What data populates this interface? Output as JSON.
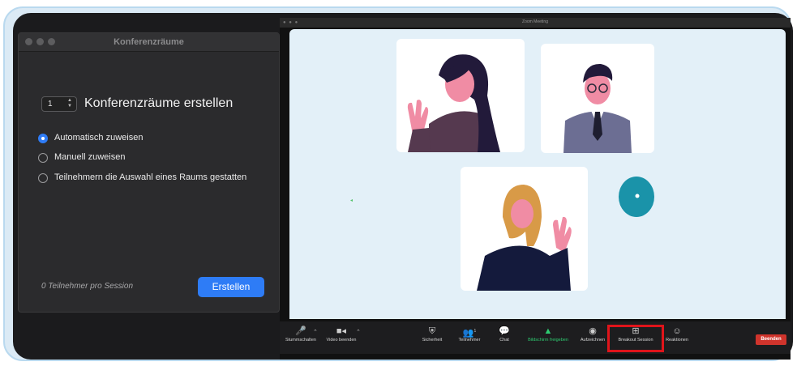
{
  "dialog": {
    "title": "Konferenzräume",
    "room_count": "1",
    "heading": "Konferenzräume erstellen",
    "options": [
      {
        "label": "Automatisch zuweisen",
        "selected": true
      },
      {
        "label": "Manuell zuweisen",
        "selected": false
      },
      {
        "label": "Teilnehmern die Auswahl eines Raums gestatten",
        "selected": false
      }
    ],
    "footnote": "0 Teilnehmer pro Session",
    "create_label": "Erstellen"
  },
  "zoom": {
    "window_title": "Zoom Meeting",
    "toolbar": [
      {
        "label": "Stummschalten",
        "icon": "microphone-icon"
      },
      {
        "label": "Video beenden",
        "icon": "video-camera-icon"
      },
      {
        "label": "Sicherheit",
        "icon": "shield-icon"
      },
      {
        "label": "Teilnehmer",
        "icon": "participants-icon",
        "count": "1"
      },
      {
        "label": "Chat",
        "icon": "chat-icon"
      },
      {
        "label": "Bildschirm freigeben",
        "icon": "share-screen-icon"
      },
      {
        "label": "Aufzeichnen",
        "icon": "record-icon"
      },
      {
        "label": "Breakout Session",
        "icon": "breakout-grid-icon"
      },
      {
        "label": "Reaktionen",
        "icon": "reactions-icon"
      }
    ],
    "end_label": "Beenden"
  },
  "colors": {
    "accent_blue": "#2f7cf6",
    "highlight_red": "#e0141a",
    "end_red": "#d0342c",
    "share_green": "#2ecc71",
    "stage_bg": "#e3f0f8"
  }
}
